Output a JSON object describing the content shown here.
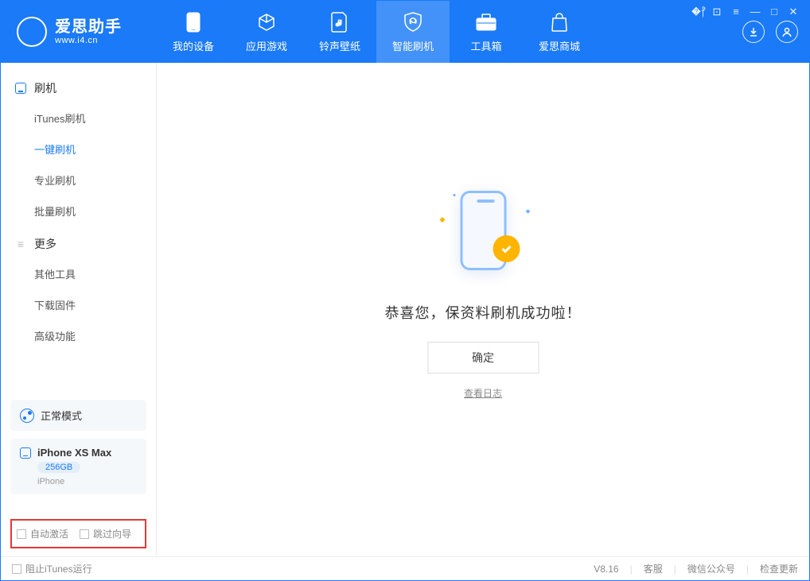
{
  "app": {
    "title": "爱思助手",
    "subtitle": "www.i4.cn"
  },
  "tabs": [
    {
      "label": "我的设备"
    },
    {
      "label": "应用游戏"
    },
    {
      "label": "铃声壁纸"
    },
    {
      "label": "智能刷机"
    },
    {
      "label": "工具箱"
    },
    {
      "label": "爱思商城"
    }
  ],
  "sidebar": {
    "group1": {
      "title": "刷机",
      "items": [
        "iTunes刷机",
        "一键刷机",
        "专业刷机",
        "批量刷机"
      ]
    },
    "group2": {
      "title": "更多",
      "items": [
        "其他工具",
        "下载固件",
        "高级功能"
      ]
    }
  },
  "device": {
    "mode": "正常模式",
    "name": "iPhone XS Max",
    "storage": "256GB",
    "type": "iPhone"
  },
  "checks": {
    "auto_activate": "自动激活",
    "skip_guide": "跳过向导"
  },
  "main": {
    "success_text": "恭喜您，保资料刷机成功啦！",
    "ok_btn": "确定",
    "log_link": "查看日志"
  },
  "footer": {
    "block_itunes": "阻止iTunes运行",
    "version": "V8.16",
    "links": [
      "客服",
      "微信公众号",
      "检查更新"
    ]
  }
}
